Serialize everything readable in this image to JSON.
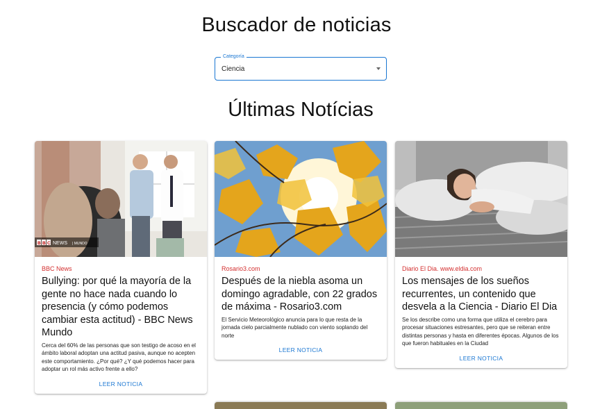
{
  "page": {
    "title": "Buscador de noticias",
    "subtitle": "Últimas Notícias"
  },
  "category_select": {
    "label": "Categoría",
    "value": "Ciencia"
  },
  "colors": {
    "accent": "#1976d2",
    "source": "#d32f2f"
  },
  "news": [
    {
      "source": "BBC News",
      "title": "Bullying: por qué la mayoría de la gente no hace nada cuando lo presencia (y cómo podemos cambiar esta actitud) - BBC News Mundo",
      "description": "Cerca del 60% de las personas que son testigo de acoso en el ámbito laboral adoptan una actitud pasiva, aunque no acepten este comportamiento. ¿Por qué? ¿Y qué podemos hacer para adoptar un rol más activo frente a ello?",
      "button": "LEER NOTICIA",
      "image_overlay": "BBC NEWS | MUNDO"
    },
    {
      "source": "Rosario3.com",
      "title": "Después de la niebla asoma un domingo agradable, con 22 grados de máxima - Rosario3.com",
      "description": "El Servicio Meteorológico anuncia para lo que resta de la jornada cielo parcialmente nublado con viento soplando del norte",
      "button": "LEER NOTICIA"
    },
    {
      "source": "Diario El Dia. www.eldia.com",
      "title": "Los mensajes de los sueños recurrentes, un contenido que desvela a la Ciencia - Diario El Dia",
      "description": "Se los describe como una forma que utiliza el cerebro para procesar situaciones estresantes, pero que se reiteran entre distintas personas y hasta en diferentes épocas. Algunos de los que fueron habituales en la Ciudad",
      "button": "LEER NOTICIA"
    }
  ]
}
